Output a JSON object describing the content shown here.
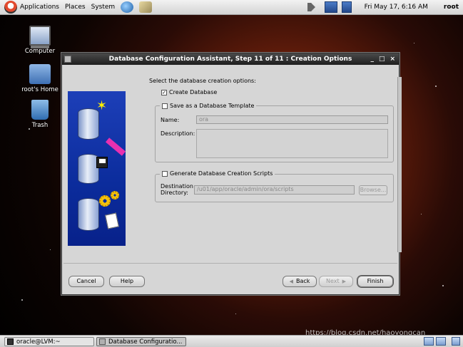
{
  "top_panel": {
    "menus": [
      "Applications",
      "Places",
      "System"
    ],
    "clock": "Fri May 17,  6:16 AM",
    "user": "root"
  },
  "desktop_icons": [
    "Computer",
    "root's Home",
    "Trash"
  ],
  "dialog": {
    "title": "Database Configuration Assistant, Step 11 of 11 : Creation Options",
    "window_buttons": [
      "_",
      "□",
      "×"
    ],
    "intro": "Select the database creation options:",
    "create_database": {
      "label": "Create Database",
      "checked": true,
      "mark": "✓"
    },
    "save_template": {
      "label": "Save as a Database Template",
      "checked": false,
      "name_label": "Name:",
      "name_value": "ora",
      "description_label": "Description:",
      "description_value": ""
    },
    "generate_scripts": {
      "label": "Generate Database Creation Scripts",
      "checked": false,
      "destination_label_1": "Destination",
      "destination_label_2": "Directory:",
      "destination_value": "/u01/app/oracle/admin/ora/scripts",
      "browse_label": "Browse..."
    },
    "buttons": {
      "cancel": "Cancel",
      "help": "Help",
      "back": "Back",
      "back_arrow": "◀",
      "next": "Next",
      "next_arrow": "▶",
      "finish": "Finish"
    }
  },
  "taskbar": {
    "tasks": [
      "oracle@LVM:~",
      "Database Configuratio..."
    ]
  },
  "watermark": "https://blog.csdn.net/haoyongcan"
}
